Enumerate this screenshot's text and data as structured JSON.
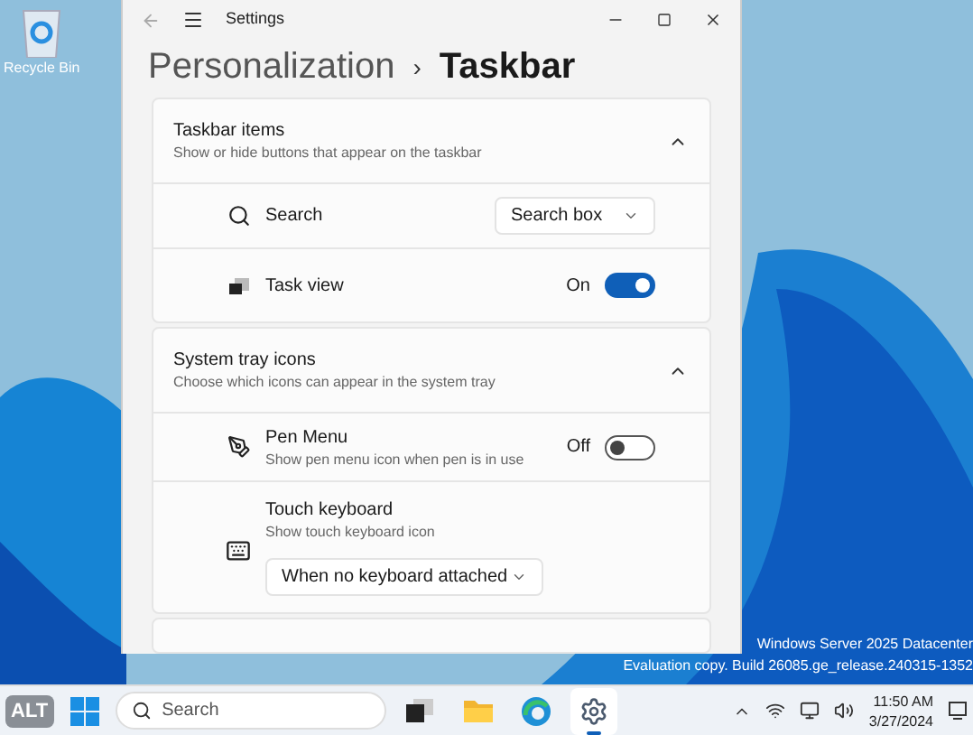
{
  "desktop": {
    "icons": [
      {
        "label": "Recycle Bin"
      }
    ],
    "watermark": [
      "Windows Server 2025 Datacenter",
      "Evaluation copy. Build 26085.ge_release.240315-1352"
    ]
  },
  "window": {
    "title": "Settings",
    "breadcrumb": {
      "parent": "Personalization",
      "separator": "›",
      "current": "Taskbar"
    }
  },
  "sections": [
    {
      "title": "Taskbar items",
      "subtitle": "Show or hide buttons that appear on the taskbar",
      "expanded": true,
      "rows": [
        {
          "kind": "dropdown",
          "label": "Search",
          "value": "Search box"
        },
        {
          "kind": "toggle",
          "label": "Task view",
          "on": true,
          "state_label": "On"
        }
      ]
    },
    {
      "title": "System tray icons",
      "subtitle": "Choose which icons can appear in the system tray",
      "expanded": true,
      "rows": [
        {
          "kind": "toggle",
          "label": "Pen Menu",
          "description": "Show pen menu icon when pen is in use",
          "on": false,
          "state_label": "Off"
        },
        {
          "kind": "dropdown_below",
          "label": "Touch keyboard",
          "description": "Show touch keyboard icon",
          "value": "When no keyboard attached"
        }
      ]
    }
  ],
  "taskbar": {
    "alt_badge": "ALT",
    "search": {
      "placeholder": "Search"
    },
    "apps": [
      {
        "kind": "taskview",
        "selected": false
      },
      {
        "kind": "explorer",
        "selected": false
      },
      {
        "kind": "edge",
        "selected": false
      },
      {
        "kind": "settings",
        "selected": true
      }
    ],
    "clock": {
      "time": "11:50 AM",
      "date": "3/27/2024"
    }
  }
}
